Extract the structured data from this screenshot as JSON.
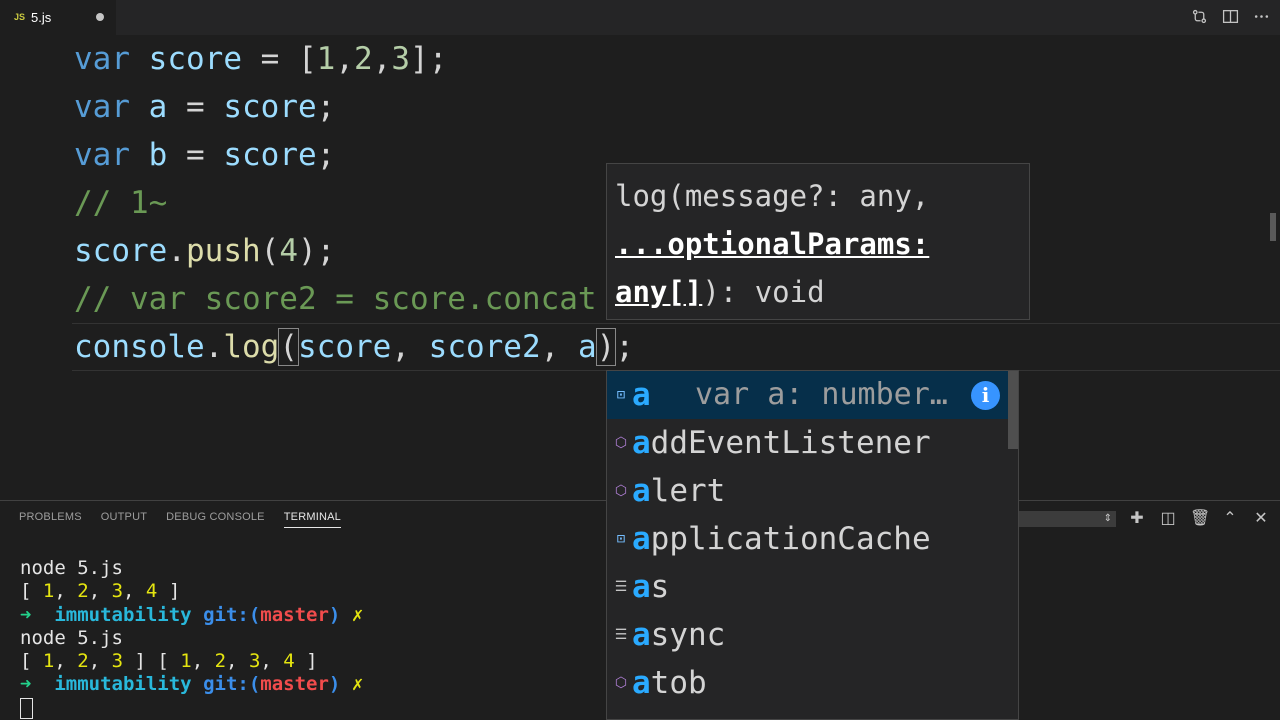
{
  "tab": {
    "icon": "JS",
    "name": "5.js"
  },
  "code": {
    "l1": {
      "kw": "var",
      "name": "score",
      "eq": " = ",
      "open": "[",
      "n1": "1",
      "c1": ",",
      "n2": "2",
      "c2": ",",
      "n3": "3",
      "close": "];"
    },
    "l2": {
      "kw": "var",
      "name": "a",
      "eq": " = ",
      "val": "score",
      "end": ";"
    },
    "l3": {
      "kw": "var",
      "name": "b",
      "eq": " = ",
      "val": "score",
      "end": ";"
    },
    "l4": {
      "comment": "// 1~"
    },
    "l5": {
      "obj": "score",
      "dot": ".",
      "fn": "push",
      "open": "(",
      "num": "4",
      "close": ");"
    },
    "l6": {
      "comment": "// var score2 = score.concat"
    },
    "l7": {
      "obj": "console",
      "dot": ".",
      "fn": "log",
      "open": "(",
      "a1": "score",
      "c1": ", ",
      "a2": "score2",
      "c2": ", ",
      "a3": "a",
      "close": ")",
      "end": ";"
    }
  },
  "signature": {
    "line1": "log(message?: any,",
    "active1": "...optionalParams:",
    "active2": "any[]",
    "rest": "): void"
  },
  "suggestions": [
    {
      "icon": "variable-icon",
      "match": "a",
      "rest": "",
      "detail": "var a: number…",
      "selected": true
    },
    {
      "icon": "method-icon",
      "match": "a",
      "rest": "ddEventListener"
    },
    {
      "icon": "method-icon",
      "match": "a",
      "rest": "lert"
    },
    {
      "icon": "variable-icon",
      "match": "a",
      "rest": "pplicationCache"
    },
    {
      "icon": "keyword-icon",
      "match": "a",
      "rest": "s"
    },
    {
      "icon": "keyword-icon",
      "match": "a",
      "rest": "sync"
    },
    {
      "icon": "method-icon",
      "match": "a",
      "rest": "tob"
    }
  ],
  "panel": {
    "tabs": [
      "PROBLEMS",
      "OUTPUT",
      "DEBUG CONSOLE",
      "TERMINAL"
    ],
    "active_tab": "TERMINAL"
  },
  "terminal": {
    "cmd1": "node 5.js",
    "out1": {
      "open": "[ ",
      "n1": "1",
      "c1": ", ",
      "n2": "2",
      "c2": ", ",
      "n3": "3",
      "c3": ", ",
      "n4": "4",
      "close": " ]"
    },
    "prompt": {
      "arrow": "➜",
      "dir": "immutability",
      "git": "git:(",
      "branch": "master",
      "gitclose": ")",
      "x": "✗"
    },
    "cmd2": "node 5.js",
    "out2": {
      "a_open": "[ ",
      "a1": "1",
      "ac1": ", ",
      "a2": "2",
      "ac2": ", ",
      "a3": "3",
      "a_close": " ] ",
      "b_open": "[ ",
      "b1": "1",
      "bc1": ", ",
      "b2": "2",
      "bc2": ", ",
      "b3": "3",
      "bc3": ", ",
      "b4": "4",
      "b_close": " ]"
    }
  }
}
